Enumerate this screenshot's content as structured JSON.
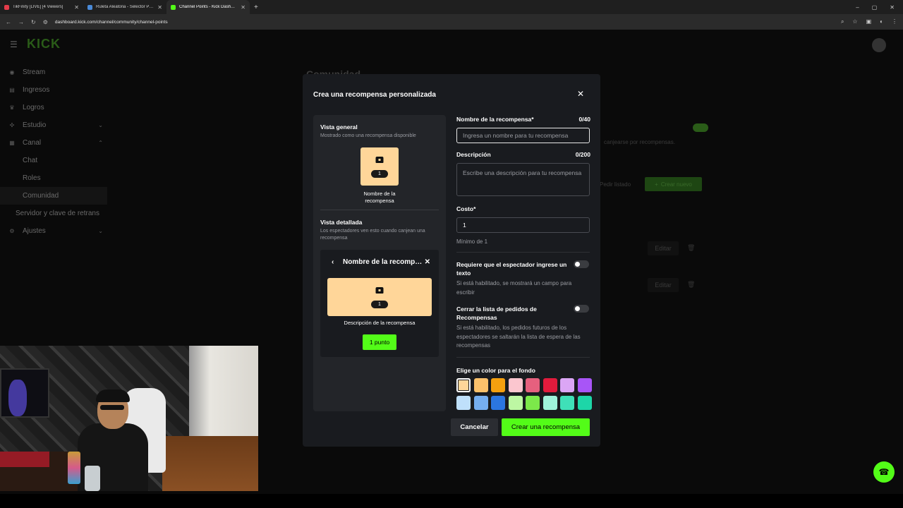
{
  "browser": {
    "tabs": [
      {
        "title": "TikFinity [LIVE] [4 Viewers]",
        "color": "#e33b4a",
        "active": false
      },
      {
        "title": "Ruleta Aleatoria - Selector Pers...",
        "color": "#4a8ad8",
        "active": false
      },
      {
        "title": "Channel Points - Kick Dashboar...",
        "color": "#53fc18",
        "active": true
      }
    ],
    "url": "dashboard.kick.com/channel/community/channel-points"
  },
  "sidebar": {
    "logo": "KICK",
    "items": [
      {
        "label": "Stream",
        "icon": "broadcast-icon"
      },
      {
        "label": "Ingresos",
        "icon": "money-icon"
      },
      {
        "label": "Logros",
        "icon": "trophy-icon"
      },
      {
        "label": "Estudio",
        "icon": "studio-icon"
      },
      {
        "label": "Canal",
        "icon": "channel-icon"
      },
      {
        "label": "Chat"
      },
      {
        "label": "Roles"
      },
      {
        "label": "Comunidad"
      },
      {
        "label": "Servidor y clave de retrans"
      },
      {
        "label": "Ajustes",
        "icon": "gear-icon"
      }
    ]
  },
  "background": {
    "title": "Comunidad",
    "toggle_text": "canjearse por recompensas.",
    "pedir": "Pedir listado",
    "crear_nuevo": "Crear nuevo",
    "edit_label": "Editar"
  },
  "modal": {
    "title": "Crea una recompensa personalizada",
    "preview": {
      "general_title": "Vista general",
      "general_sub": "Mostrado como una recompensa disponible",
      "cost": "1",
      "reward_name": "Nombre de la recompensa",
      "detail_title": "Vista detallada",
      "detail_sub": "Los espectadores ven esto cuando canjean una recompensa",
      "detail_name": "Nombre de la recompensa",
      "detail_desc": "Descripción de la recompensa",
      "point_button": "1 punto"
    },
    "form": {
      "name_label": "Nombre de la recompensa*",
      "name_count": "0/40",
      "name_placeholder": "Ingresa un nombre para tu recompensa",
      "desc_label": "Descripción",
      "desc_count": "0/200",
      "desc_placeholder": "Escribe una descripción para tu recompensa",
      "cost_label": "Costo*",
      "cost_value": "1",
      "cost_hint": "Mínimo de 1",
      "toggle1_label": "Requiere que el espectador ingrese un texto",
      "toggle1_desc": "Si está habilitado, se mostrará un campo para escribir",
      "toggle2_label": "Cerrar la lista de pedidos de Recompensas",
      "toggle2_desc": "Si está habilitado, los pedidos futuros de los espectadores se saltarán la lista de espera de las recompensas",
      "color_label": "Elige un color para el fondo",
      "colors": [
        "#ffd699",
        "#fbc16b",
        "#f5a00f",
        "#fbc6cf",
        "#e6607e",
        "#e01b3c",
        "#dba6f5",
        "#a855f7",
        "#bfe0fb",
        "#75aef0",
        "#2b76e0",
        "#bdf7a3",
        "#7ce84a",
        "#9ff2da",
        "#3fe0b8",
        "#1dd6a8"
      ],
      "cancel": "Cancelar",
      "create": "Crear una recompensa"
    }
  }
}
